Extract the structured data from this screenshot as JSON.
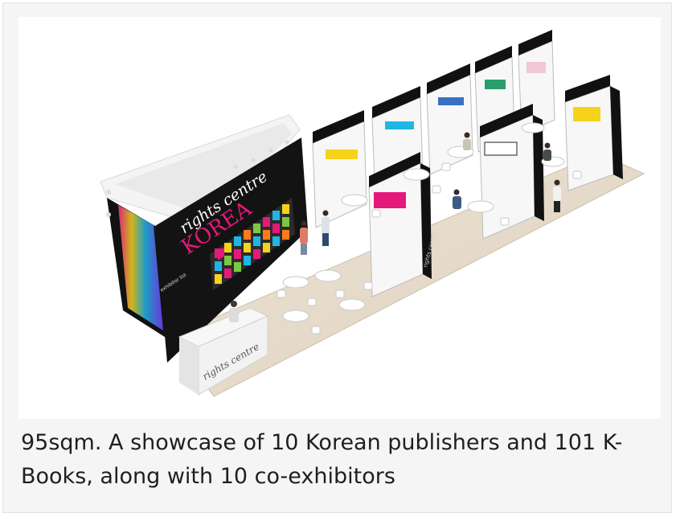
{
  "caption": "95sqm. A showcase of 10 Korean publishers and 101 K-Books, along with 10 co-exhibitors",
  "booth": {
    "wall_heading_line1": "rights centre",
    "wall_heading_line2": "KOREA",
    "wall_exhibitor_label": "exhibitor list",
    "desk_label": "rights centre",
    "column_label": "rights centre"
  },
  "colors": {
    "floor": "#e7dccb",
    "wall": "#131313",
    "canopy": "#f4f4f4",
    "magenta": "#e6187c",
    "cyan": "#1fb6e6",
    "yellow": "#f5d31a"
  }
}
